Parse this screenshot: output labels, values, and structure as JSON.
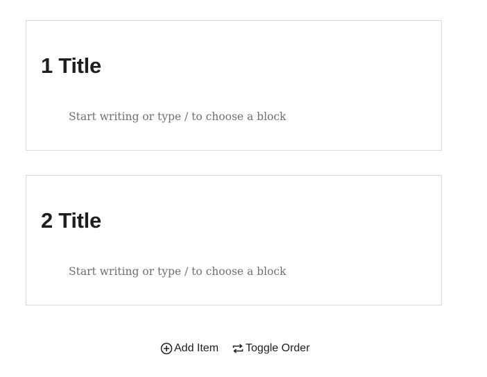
{
  "blocks": [
    {
      "title": "1 Title",
      "placeholder": "Start writing or type / to choose a block"
    },
    {
      "title": "2 Title",
      "placeholder": "Start writing or type / to choose a block"
    }
  ],
  "actions": {
    "add_item": {
      "label": "Add Item",
      "icon": "plus-circle-icon"
    },
    "toggle_order": {
      "label": "Toggle Order",
      "icon": "repeat-icon"
    }
  },
  "colors": {
    "text": "#1e1e1e",
    "placeholder": "#6f6f6f",
    "border": "#d9d9d9"
  }
}
